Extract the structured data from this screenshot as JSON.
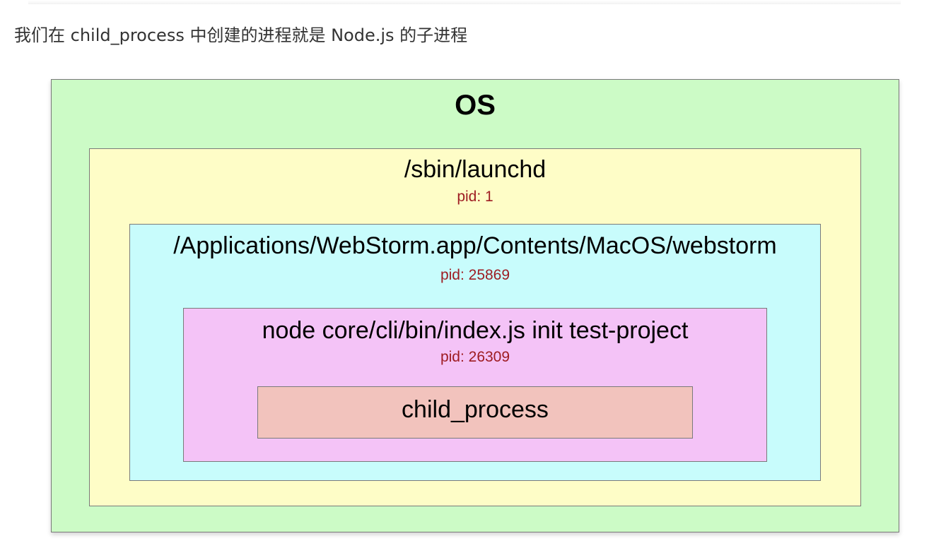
{
  "caption": "我们在 child_process 中创建的进程就是 Node.js 的子进程",
  "diagram": {
    "os": {
      "title": "OS"
    },
    "launchd": {
      "title": "/sbin/launchd",
      "pid": "pid: 1"
    },
    "webstorm": {
      "title": "/Applications/WebStorm.app/Contents/MacOS/webstorm",
      "pid": "pid: 25869"
    },
    "node": {
      "title": "node core/cli/bin/index.js init test-project",
      "pid": "pid: 26309"
    },
    "child": {
      "title": "child_process"
    }
  },
  "colors": {
    "os_fill": "#ccfbc6",
    "launchd_fill": "#fefdc7",
    "webstorm_fill": "#c8fcfc",
    "node_fill": "#f4c3f7",
    "child_fill": "#f2c3bd",
    "pid_text": "#9e1c22"
  }
}
